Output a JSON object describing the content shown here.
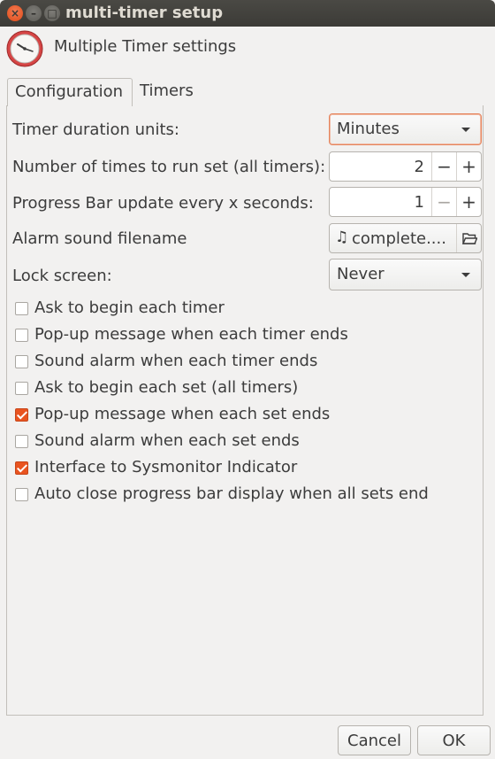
{
  "window": {
    "title": "multi-timer setup",
    "close_glyph": "×",
    "minimize_glyph": "–",
    "maximize_glyph": "□"
  },
  "header": {
    "icon": "clock-icon",
    "title": "Multiple Timer settings"
  },
  "tabs": [
    {
      "label": "Configuration",
      "active": true
    },
    {
      "label": "Timers",
      "active": false
    }
  ],
  "config": {
    "duration_units": {
      "label": "Timer duration units:",
      "value": "Minutes"
    },
    "run_set_times": {
      "label": "Number of times to run set (all timers):",
      "value": "2",
      "minus": "−",
      "plus": "+"
    },
    "progress_update": {
      "label": "Progress Bar update every x seconds:",
      "value": "1",
      "minus": "−",
      "plus": "+"
    },
    "alarm_sound": {
      "label": "Alarm sound filename",
      "value": "complete....",
      "icon": "music-note-icon",
      "note_glyph": "♫"
    },
    "lock_screen": {
      "label": "Lock screen:",
      "value": "Never"
    }
  },
  "checkboxes": [
    {
      "label": "Ask to begin each timer",
      "checked": false
    },
    {
      "label": "Pop-up message when each timer ends",
      "checked": false
    },
    {
      "label": "Sound alarm when each timer ends",
      "checked": false
    },
    {
      "label": "Ask to begin each set (all timers)",
      "checked": false
    },
    {
      "label": "Pop-up message when each set ends",
      "checked": true
    },
    {
      "label": "Sound alarm when each set ends",
      "checked": false
    },
    {
      "label": "Interface to Sysmonitor Indicator",
      "checked": true
    },
    {
      "label": "Auto close progress bar display when all sets end",
      "checked": false
    }
  ],
  "buttons": {
    "cancel": "Cancel",
    "ok": "OK"
  },
  "colors": {
    "accent": "#e95420",
    "titlebar": "#3c3b37",
    "background": "#f2f1f0"
  }
}
